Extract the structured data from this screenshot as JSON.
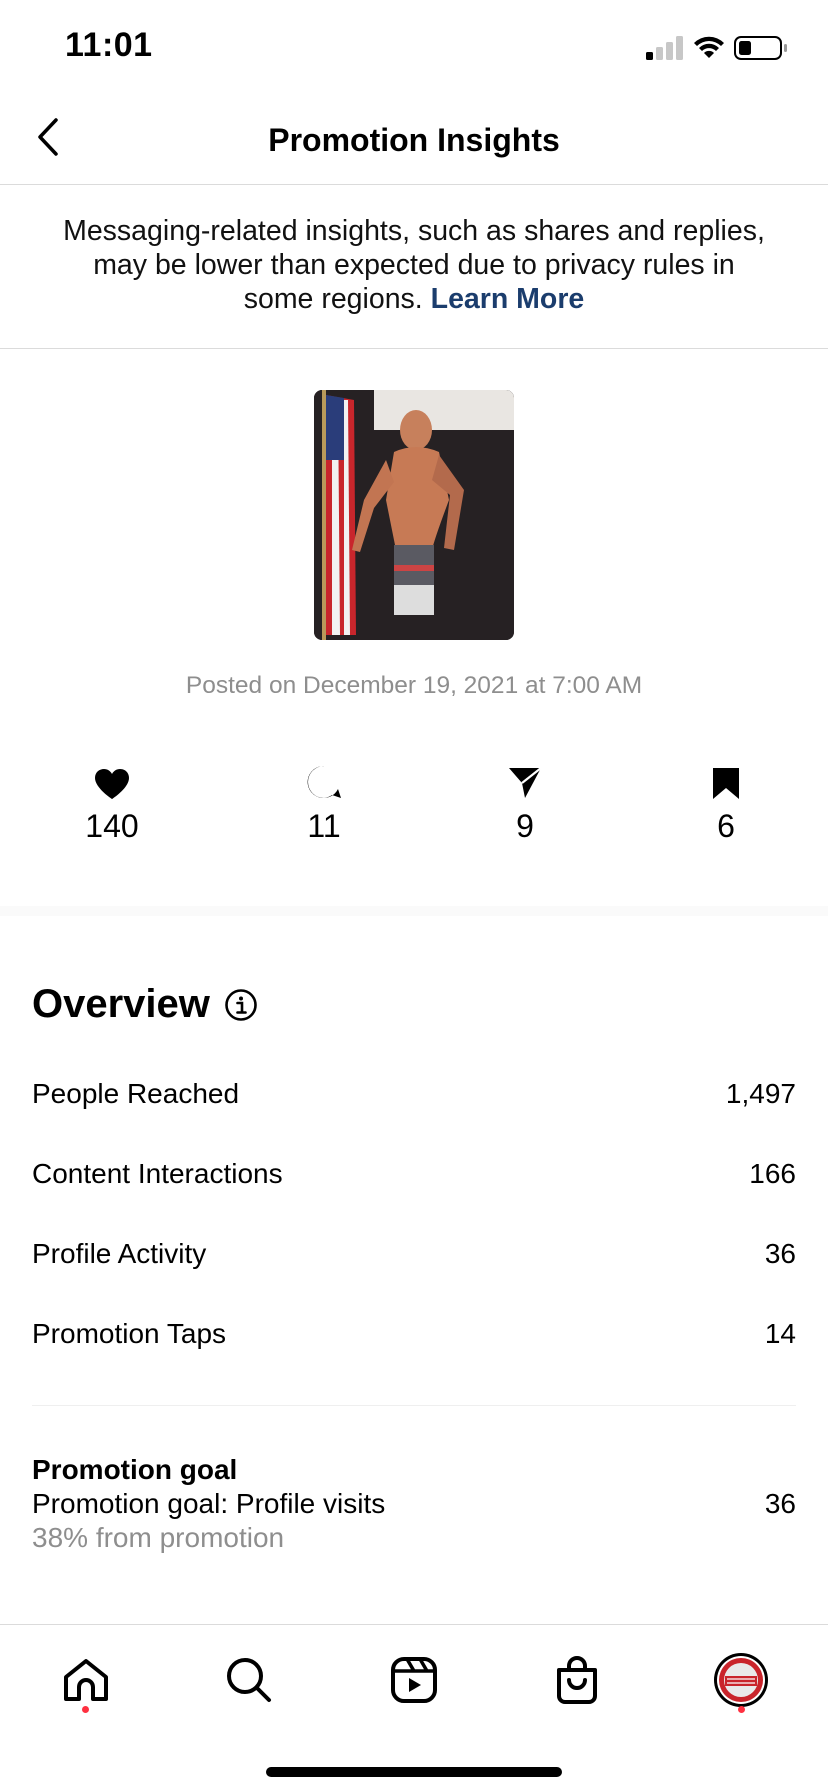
{
  "status_bar": {
    "time": "11:01"
  },
  "header": {
    "title": "Promotion Insights"
  },
  "notice": {
    "text": "Messaging-related insights, such as shares and replies, may be lower than expected due to privacy rules in some regions.",
    "link": "Learn More"
  },
  "post": {
    "posted_on": "Posted on December 19, 2021 at 7:00 AM"
  },
  "stats": [
    {
      "icon": "heart-icon",
      "value": "140"
    },
    {
      "icon": "comment-icon",
      "value": "11"
    },
    {
      "icon": "share-icon",
      "value": "9"
    },
    {
      "icon": "bookmark-icon",
      "value": "6"
    }
  ],
  "overview": {
    "title": "Overview",
    "rows": [
      {
        "label": "People Reached",
        "value": "1,497"
      },
      {
        "label": "Content Interactions",
        "value": "166"
      },
      {
        "label": "Profile Activity",
        "value": "36"
      },
      {
        "label": "Promotion Taps",
        "value": "14"
      }
    ]
  },
  "promotion_goal": {
    "heading": "Promotion goal",
    "label": "Promotion goal: Profile visits",
    "value": "36",
    "sub": "38% from promotion"
  },
  "tab_bar": {
    "items": [
      "home-icon",
      "search-icon",
      "reels-icon",
      "shop-icon",
      "profile-avatar"
    ]
  },
  "colors": {
    "link": "#1b3d6d",
    "notification_dot": "#ff3040",
    "muted": "#8e8e8e"
  }
}
